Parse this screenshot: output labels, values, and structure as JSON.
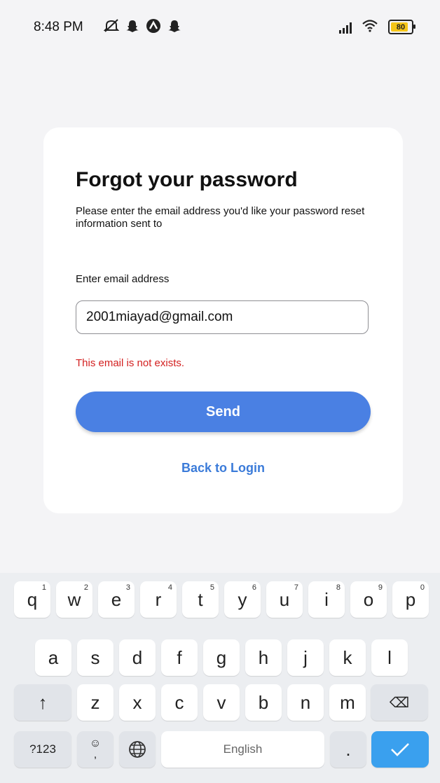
{
  "status_bar": {
    "time": "8:48 PM",
    "battery": "80",
    "icons": [
      "mute-icon",
      "snapchat-icon",
      "expo-icon",
      "snapchat-icon",
      "signal-icon",
      "wifi-icon",
      "battery-icon"
    ]
  },
  "form": {
    "title": "Forgot your password",
    "subtitle": "Please enter the email address you'd like your password reset information sent to",
    "email_label": "Enter email address",
    "email_value": "2001miayad@gmail.com",
    "error": "This email is not exists.",
    "send_label": "Send",
    "back_label": "Back to Login",
    "accent": "#4a80e3",
    "error_color": "#d32020"
  },
  "keyboard": {
    "row1": [
      {
        "k": "q",
        "n": "1"
      },
      {
        "k": "w",
        "n": "2"
      },
      {
        "k": "e",
        "n": "3"
      },
      {
        "k": "r",
        "n": "4"
      },
      {
        "k": "t",
        "n": "5"
      },
      {
        "k": "y",
        "n": "6"
      },
      {
        "k": "u",
        "n": "7"
      },
      {
        "k": "i",
        "n": "8"
      },
      {
        "k": "o",
        "n": "9"
      },
      {
        "k": "p",
        "n": "0"
      }
    ],
    "row2": [
      "a",
      "s",
      "d",
      "f",
      "g",
      "h",
      "j",
      "k",
      "l"
    ],
    "row3": [
      "z",
      "x",
      "c",
      "v",
      "b",
      "n",
      "m"
    ],
    "shift": "↑",
    "backspace": "⌫",
    "sym_label": "?123",
    "emoji": "☺",
    "comma": ",",
    "globe": "🌐",
    "space_label": "English",
    "period": ".",
    "done": "✓",
    "done_color": "#3aa0ee"
  }
}
